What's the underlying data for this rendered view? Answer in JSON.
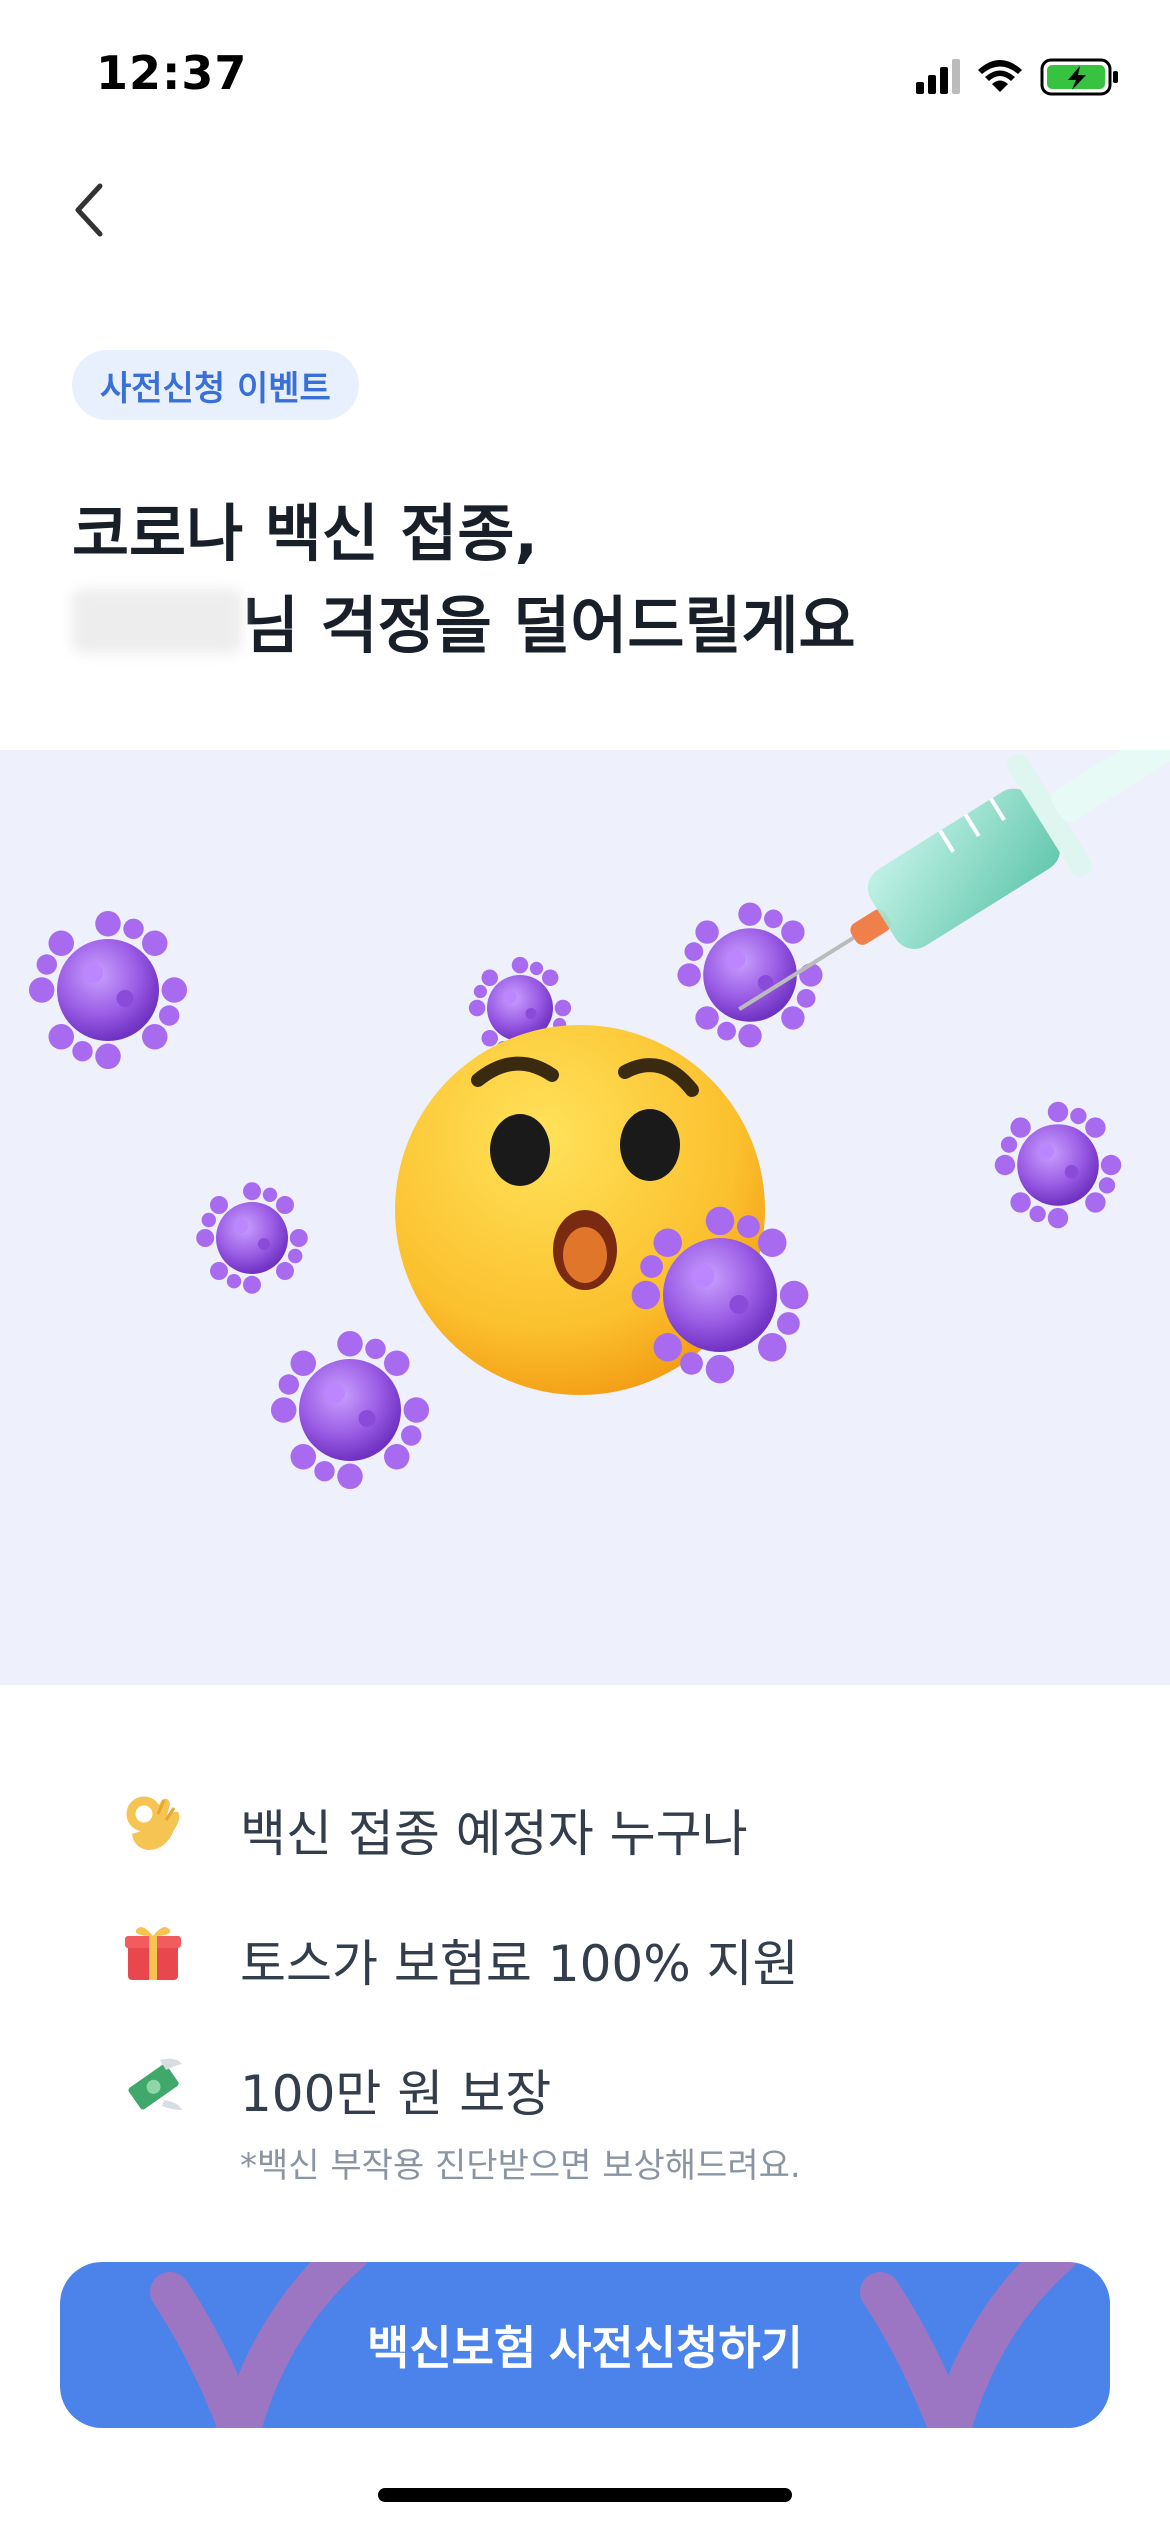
{
  "status_bar": {
    "time": "12:37"
  },
  "event_badge": "사전신청 이벤트",
  "headline": {
    "line1": "코로나 백신 접종,",
    "line2_suffix": "님 걱정을 덜어드릴게요"
  },
  "hero": {
    "icon": "worried-emoji-virus-syringe-illustration"
  },
  "features": [
    {
      "icon": "ok-hand-icon",
      "label": "백신 접종 예정자 누구나"
    },
    {
      "icon": "gift-icon",
      "label": "토스가 보험료 100% 지원"
    },
    {
      "icon": "money-wings-icon",
      "label": "100만 원 보장",
      "note": "*백신 부작용 진단받으면 보상해드려요."
    }
  ],
  "cta": {
    "label": "백신보험 사전신청하기"
  },
  "colors": {
    "accent": "#4b83ea",
    "badge_bg": "#e8f0fd",
    "badge_text": "#3a6fd8",
    "hero_bg": "#eef0fb",
    "virus": "#9b5de5"
  }
}
